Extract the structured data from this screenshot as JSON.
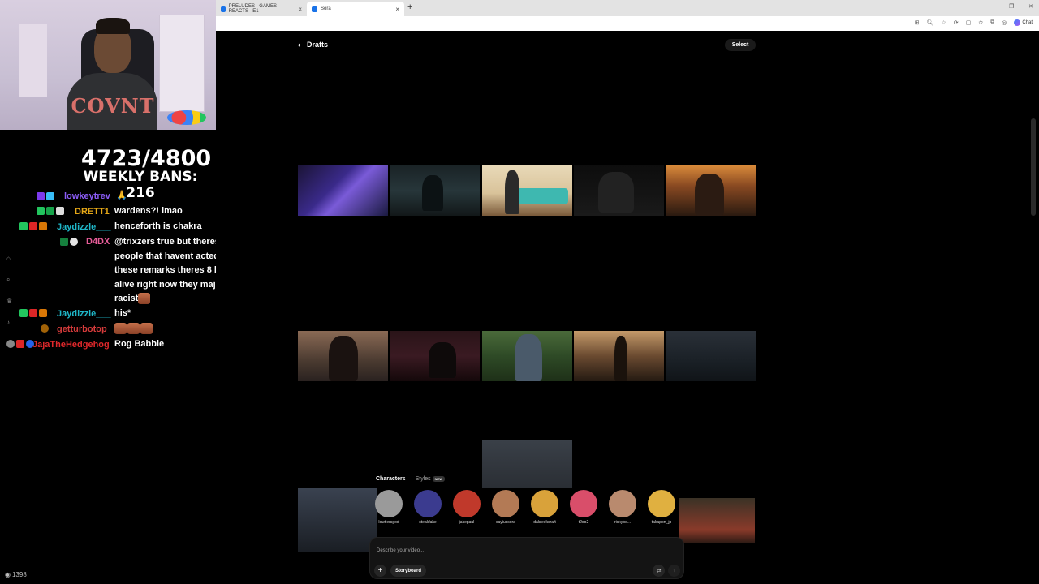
{
  "browser": {
    "tabs": [
      {
        "title": "PRELUDES - GAMES - REACTS - E1"
      },
      {
        "title": "Sora"
      }
    ],
    "new_tab": "+",
    "chat_label": "Chat"
  },
  "stream": {
    "counter": "4723/4800",
    "weekly_bans": "WEEKLY BANS: 216",
    "shirt_text": "COVNT",
    "viewer_count": "1398",
    "chat": [
      {
        "user": "lowkeytrev",
        "color": "#8b5cf6",
        "text": "🙏"
      },
      {
        "user": "DRETT1",
        "color": "#e6a817",
        "text": "wardens?! lmao"
      },
      {
        "user": "Jaydizzle___",
        "color": "#1fb7c9",
        "text": "henceforth is chakra"
      },
      {
        "user": "D4DX",
        "color": "#e85d9a",
        "text": "@trixzers true but theres still plently of people that havent acted or made all these remarks theres 8 billion people alive right now they majority is not racist"
      },
      {
        "user": "Jaydizzle___",
        "color": "#1fb7c9",
        "text": "his*"
      },
      {
        "user": "getturbotop",
        "color": "#d63b3b",
        "text": ""
      },
      {
        "user": "JajaTheHedgehog",
        "color": "#e0282b",
        "text": "Rog Babble"
      }
    ]
  },
  "sora": {
    "header_title": "Drafts",
    "select_label": "Select",
    "tabs": {
      "characters": "Characters",
      "styles": "Styles",
      "new_badge": "NEW"
    },
    "characters": [
      {
        "name": "lowtiersgod",
        "color": "#9a9a9a"
      },
      {
        "name": "steakfake",
        "color": "#3b3b8f"
      },
      {
        "name": "jakepaul",
        "color": "#c0392b"
      },
      {
        "name": "cayiussora",
        "color": "#b37a55"
      },
      {
        "name": "dakreekcraft",
        "color": "#d9a23a"
      },
      {
        "name": "t2oo2",
        "color": "#d94e6a"
      },
      {
        "name": "rickybe...",
        "color": "#b98a6e"
      },
      {
        "name": "takapon_jp",
        "color": "#e0b040"
      }
    ],
    "prompt_placeholder": "Describe your video...",
    "storyboard_label": "Storyboard"
  }
}
